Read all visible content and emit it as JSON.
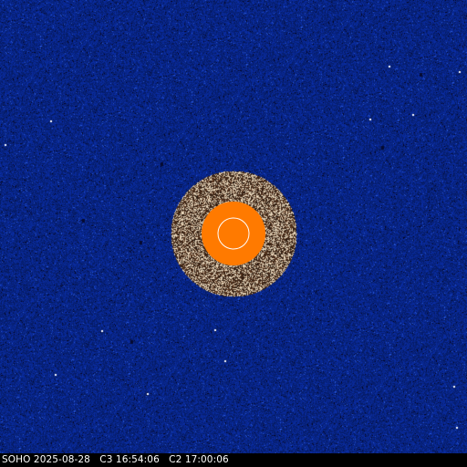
{
  "image": {
    "caption": "SOHO 2025-08-28   C3 16:54:06   C2 17:00:06",
    "colors": {
      "background": "#0a2ea8",
      "occulter_disk": "#ff7a00",
      "sun_outline": "#ffffff",
      "inner_field_light": "#f3e6cf",
      "inner_field_dark": "#3a2010",
      "caption_bar": "#000000",
      "caption_text": "#ffffff"
    }
  }
}
